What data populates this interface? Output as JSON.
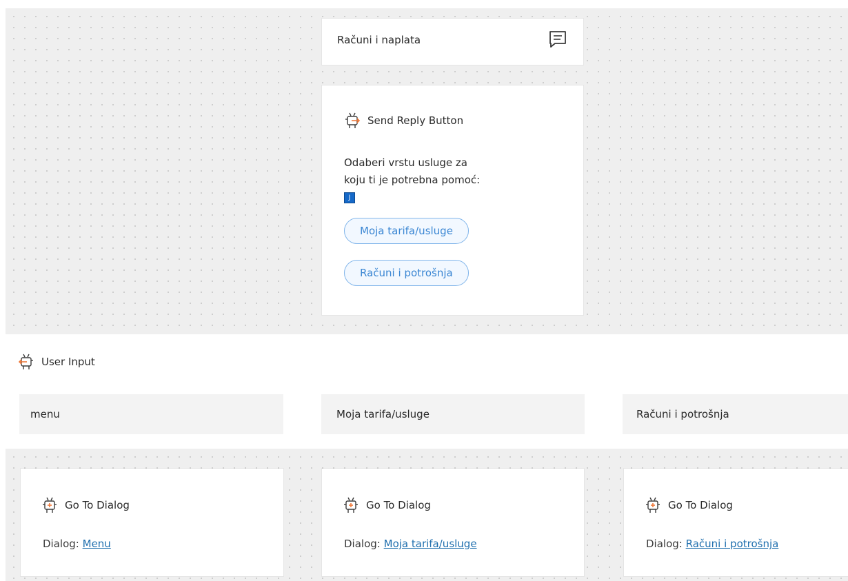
{
  "topic": {
    "title": "Računi i naplata",
    "icon": "chat-bubble-icon"
  },
  "send_reply": {
    "step_title": "Send Reply Button",
    "icon": "robot-send-icon",
    "message_line1": "Odaberi vrstu usluge za",
    "message_line2": "koju ti je potrebna pomoć:",
    "emoji": "J",
    "buttons": [
      {
        "label": "Moja tarifa/usluge"
      },
      {
        "label": "Računi i potrošnja"
      }
    ]
  },
  "user_input": {
    "label": "User Input",
    "icon": "robot-input-icon",
    "options": [
      {
        "value": "menu"
      },
      {
        "value": "Moja tarifa/usluge"
      },
      {
        "value": "Računi i potrošnja"
      }
    ]
  },
  "goto_dialogs": [
    {
      "title": "Go To Dialog",
      "prefix": "Dialog:",
      "link": "Menu"
    },
    {
      "title": "Go To Dialog",
      "prefix": "Dialog:",
      "link": "Moja tarifa/usluge"
    },
    {
      "title": "Go To Dialog",
      "prefix": "Dialog:",
      "link": "Računi i potrošnja"
    }
  ],
  "colors": {
    "accent_orange": "#f07a3a",
    "pill_border": "#7fb4ea",
    "pill_text": "#3a86d3",
    "link": "#1f6fae",
    "canvas": "#efefef"
  }
}
